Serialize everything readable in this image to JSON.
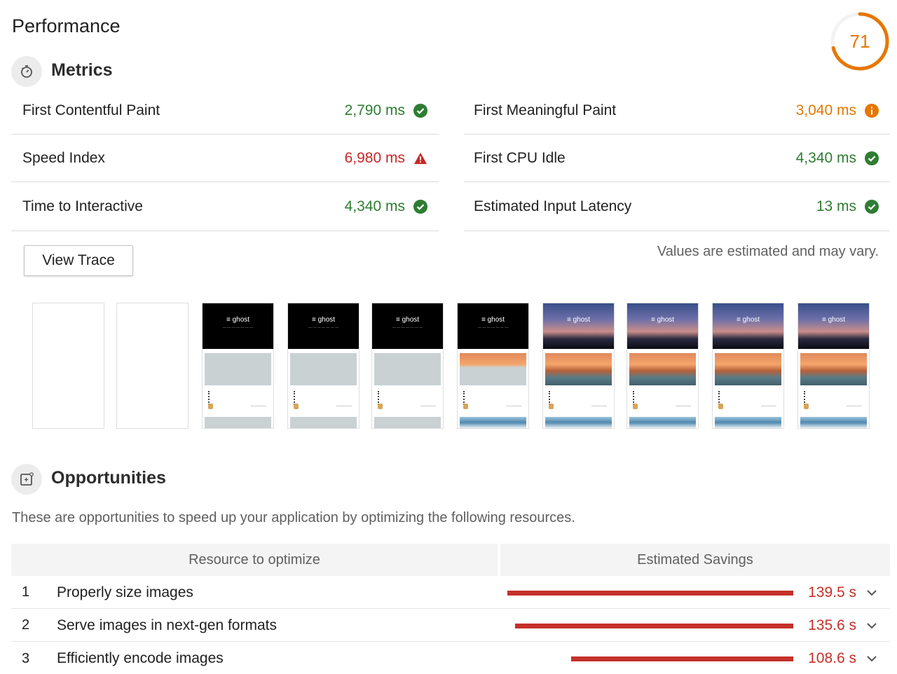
{
  "page": {
    "title": "Performance"
  },
  "score": {
    "value": "71",
    "fraction": 0.71,
    "color": "#e67700"
  },
  "metrics": {
    "title": "Metrics",
    "icon": "stopwatch-icon",
    "left": [
      {
        "name": "First Contentful Paint",
        "value": "2,790 ms",
        "status": "pass",
        "icon": "check-circle-icon"
      },
      {
        "name": "Speed Index",
        "value": "6,980 ms",
        "status": "fail",
        "icon": "warning-triangle-icon"
      },
      {
        "name": "Time to Interactive",
        "value": "4,340 ms",
        "status": "pass",
        "icon": "check-circle-icon"
      }
    ],
    "right": [
      {
        "name": "First Meaningful Paint",
        "value": "3,040 ms",
        "status": "average",
        "icon": "info-circle-icon"
      },
      {
        "name": "First CPU Idle",
        "value": "4,340 ms",
        "status": "pass",
        "icon": "check-circle-icon"
      },
      {
        "name": "Estimated Input Latency",
        "value": "13 ms",
        "status": "pass",
        "icon": "check-circle-icon"
      }
    ],
    "view_trace_label": "View Trace",
    "note": "Values are estimated and may vary."
  },
  "filmstrip": {
    "frames": 10
  },
  "opportunities": {
    "title": "Opportunities",
    "icon": "opportunity-icon",
    "description": "These are opportunities to speed up your application by optimizing the following resources.",
    "columns": [
      "Resource to optimize",
      "Estimated Savings"
    ],
    "rows": [
      {
        "num": "1",
        "name": "Properly size images",
        "savings": "139.5 s",
        "ratio": 1.0
      },
      {
        "num": "2",
        "name": "Serve images in next-gen formats",
        "savings": "135.6 s",
        "ratio": 0.972
      },
      {
        "num": "3",
        "name": "Efficiently encode images",
        "savings": "108.6 s",
        "ratio": 0.778
      }
    ]
  },
  "colors": {
    "pass": "#2e7d32",
    "average": "#e67700",
    "fail": "#c62828",
    "bar": "#c5302a"
  }
}
